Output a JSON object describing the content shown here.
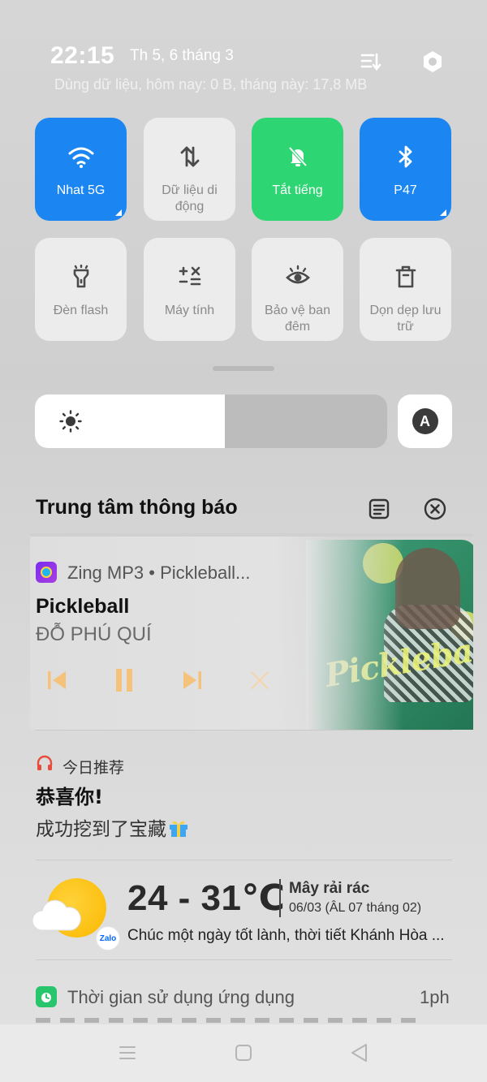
{
  "header": {
    "time": "22:15",
    "date": "Th 5, 6 tháng 3",
    "data_usage": "Dùng dữ liệu, hôm nay: 0 B, tháng này: 17,8 MB"
  },
  "tiles": [
    {
      "label": "Nhat 5G",
      "state": "on",
      "color": "#1b86f2",
      "icon": "wifi-icon"
    },
    {
      "label": "Dữ liệu di động",
      "state": "off",
      "icon": "mobile-data-icon"
    },
    {
      "label": "Tắt tiếng",
      "state": "on",
      "color": "#2ed573",
      "icon": "bell-off-icon"
    },
    {
      "label": "P47",
      "state": "on",
      "color": "#1b86f2",
      "icon": "bluetooth-icon"
    },
    {
      "label": "Đèn flash",
      "state": "off",
      "icon": "flashlight-icon"
    },
    {
      "label": "Máy tính",
      "state": "off",
      "icon": "calculator-icon"
    },
    {
      "label": "Bảo vệ ban đêm",
      "state": "off",
      "icon": "eye-icon"
    },
    {
      "label": "Dọn dẹp lưu trữ",
      "state": "off",
      "icon": "trash-icon"
    }
  ],
  "brightness": {
    "level": 0.54,
    "auto_label": "A"
  },
  "notification_center": {
    "title": "Trung tâm thông báo"
  },
  "music": {
    "app": "Zing MP3 • Pickleball...",
    "title": "Pickleball",
    "artist": "ĐỖ PHÚ QUÍ",
    "art_text": "Pickleball"
  },
  "cn_notification": {
    "app": "今日推荐",
    "title": "恭喜你!",
    "body": "成功挖到了宝藏"
  },
  "weather": {
    "temp": "24 - 31℃",
    "condition": "Mây rải rác",
    "date": "06/03 (ÂL 07 tháng 02)",
    "message": "Chúc một ngày tốt lành, thời tiết Khánh Hòa ...",
    "badge": "Zalo"
  },
  "screen_time": {
    "app": "Thời gian sử dụng ứng dụng",
    "time": "1ph"
  },
  "colors": {
    "accent_blue": "#1b86f2",
    "accent_green": "#2ed573",
    "music_controls": "#f4c27a"
  }
}
